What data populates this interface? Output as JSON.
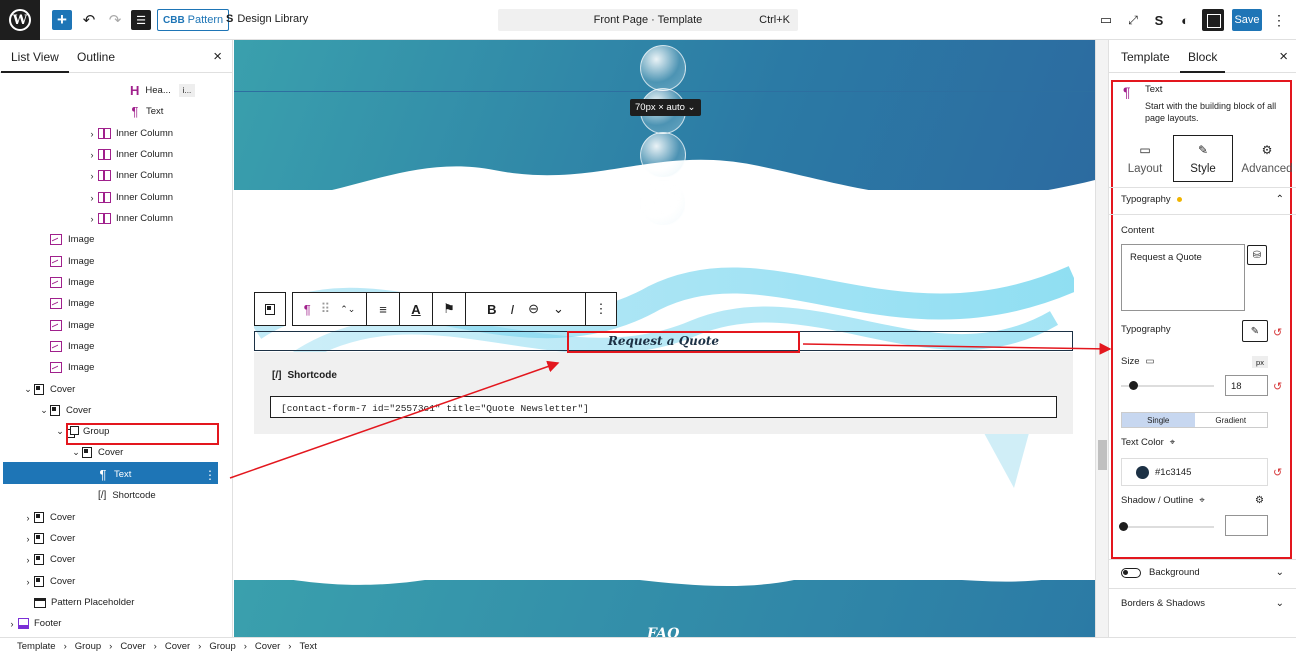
{
  "topbar": {
    "pattern_label": "Pattern",
    "pattern_brand": "CBB",
    "design_library": "Design Library",
    "command": "Front Page · Template",
    "shortcut": "Ctrl+K",
    "save": "Save"
  },
  "left_panel": {
    "tabs": [
      "List View",
      "Outline"
    ],
    "tree": [
      {
        "label": "Hea...",
        "extra": "i...",
        "icon": "heading"
      },
      {
        "label": "Text",
        "icon": "paragraph"
      },
      {
        "label": "Inner Column",
        "icon": "column"
      },
      {
        "label": "Inner Column",
        "icon": "column"
      },
      {
        "label": "Inner Column",
        "icon": "column"
      },
      {
        "label": "Inner Column",
        "icon": "column"
      },
      {
        "label": "Inner Column",
        "icon": "column"
      },
      {
        "label": "Image",
        "icon": "image"
      },
      {
        "label": "Image",
        "icon": "image"
      },
      {
        "label": "Image",
        "icon": "image"
      },
      {
        "label": "Image",
        "icon": "image"
      },
      {
        "label": "Image",
        "icon": "image"
      },
      {
        "label": "Image",
        "icon": "image"
      },
      {
        "label": "Image",
        "icon": "image"
      },
      {
        "label": "Cover",
        "icon": "cover"
      },
      {
        "label": "Cover",
        "icon": "cover"
      },
      {
        "label": "Group",
        "icon": "group"
      },
      {
        "label": "Cover",
        "icon": "cover"
      },
      {
        "label": "Text",
        "icon": "paragraph",
        "selected": true
      },
      {
        "label": "Shortcode",
        "icon": "shortcode"
      },
      {
        "label": "Cover",
        "icon": "cover"
      },
      {
        "label": "Cover",
        "icon": "cover"
      },
      {
        "label": "Cover",
        "icon": "cover"
      },
      {
        "label": "Cover",
        "icon": "cover"
      },
      {
        "label": "Pattern Placeholder",
        "icon": "placeholder"
      },
      {
        "label": "Footer",
        "icon": "footer"
      }
    ]
  },
  "canvas": {
    "size_badge": "70px × auto",
    "text_content": "Request a Quote",
    "shortcode_label": "Shortcode",
    "shortcode_value": "[contact-form-7 id=\"25573c1\" title=\"Quote Newsletter\"]",
    "faq": "FAQ"
  },
  "right_panel": {
    "tabs": [
      "Template",
      "Block"
    ],
    "block_title": "Text",
    "block_desc": "Start with the building block of all page layouts.",
    "sub_tabs": [
      "Layout",
      "Style",
      "Advanced"
    ],
    "typography_section": "Typography",
    "content_label": "Content",
    "content_value": "Request a Quote",
    "typography_label": "Typography",
    "size_label": "Size",
    "size_unit": "px",
    "size_value": "18",
    "size_fraction": 0.12,
    "color_modes": [
      "Single",
      "Gradient"
    ],
    "text_color_label": "Text Color",
    "text_color_value": "#1c3145",
    "shadow_label": "Shadow / Outline",
    "background_label": "Background",
    "borders_label": "Borders & Shadows"
  },
  "breadcrumb": [
    "Template",
    "Group",
    "Cover",
    "Cover",
    "Group",
    "Cover",
    "Text"
  ],
  "colors": {
    "accent": "#1e75b6",
    "annotation": "#e3171e",
    "text_color": "#1c3145"
  }
}
